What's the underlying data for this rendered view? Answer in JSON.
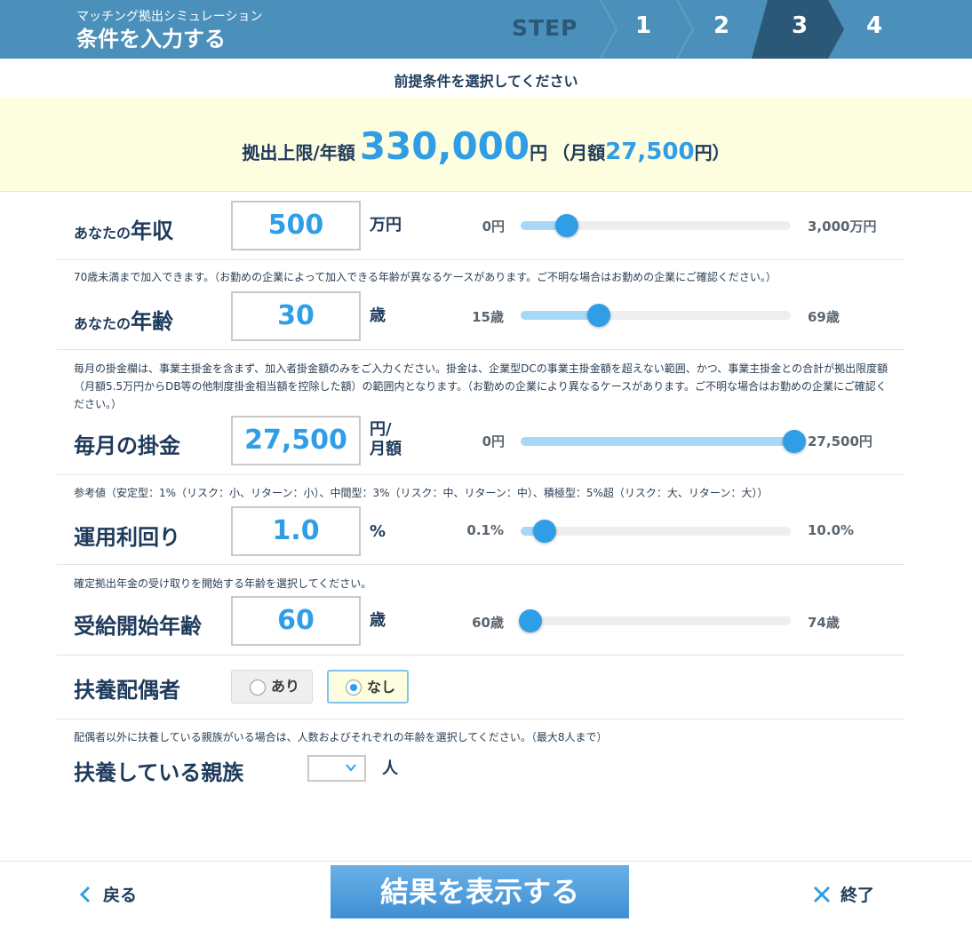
{
  "header": {
    "subtitle": "マッチング拠出シミュレーション",
    "title": "条件を入力する",
    "step_label": "STEP",
    "steps": [
      "1",
      "2",
      "3",
      "4"
    ],
    "current_step": "3"
  },
  "subheader": "前提条件を選択してください",
  "limit": {
    "label": "拠出上限/年額",
    "amount": "330,000",
    "yen": "円",
    "monthly_open": "（月額",
    "monthly_amount": "27,500",
    "monthly_close": "円）"
  },
  "income": {
    "label_small": "あなたの",
    "label": "年収",
    "value": "500",
    "unit": "万円",
    "min": "0円",
    "max": "3,000万円",
    "slider_level": 0.17
  },
  "age": {
    "note": "70歳未満まで加入できます。（お勤めの企業によって加入できる年齢が異なるケースがあります。ご不明な場合はお勤めの企業にご確認ください。）",
    "label_small": "あなたの",
    "label": "年齢",
    "value": "30",
    "unit": "歳",
    "min": "15歳",
    "max": "69歳",
    "slider_level": 0.29
  },
  "contribution": {
    "note": "毎月の掛金欄は、事業主掛金を含まず、加入者掛金額のみをご入力ください。掛金は、企業型DCの事業主掛金額を超えない範囲、かつ、事業主掛金との合計が拠出限度額（月額5.5万円からDB等の他制度掛金相当額を控除した額）の範囲内となります。（お勤めの企業により異なるケースがあります。ご不明な場合はお勤めの企業にご確認ください。）",
    "label": "毎月の掛金",
    "value": "27,500",
    "unit_line1": "円/",
    "unit_line2": "月額",
    "min": "0円",
    "max": "27,500円",
    "slider_level": 1.0
  },
  "yield": {
    "note": "参考値（安定型：1%（リスク：小、リターン：小）、中間型：3%（リスク：中、リターン：中）、積極型：5%超（リスク：大、リターン：大））",
    "label": "運用利回り",
    "value": "1.0",
    "unit": "%",
    "min": "0.1%",
    "max": "10.0%",
    "slider_level": 0.09
  },
  "start_age": {
    "note": "確定拠出年金の受け取りを開始する年齢を選択してください。",
    "label": "受給開始年齢",
    "value": "60",
    "unit": "歳",
    "min": "60歳",
    "max": "74歳",
    "slider_level": 0.0
  },
  "spouse": {
    "label": "扶養配偶者",
    "option_yes": "あり",
    "option_no": "なし",
    "selected": "なし"
  },
  "dependents": {
    "note": "配偶者以外に扶養している親族がいる場合は、人数およびそれぞれの年齢を選択してください。（最大8人まで）",
    "label": "扶養している親族",
    "unit": "人",
    "value": ""
  },
  "footer": {
    "back": "戻る",
    "result": "結果を表示する",
    "close": "終了"
  },
  "colors": {
    "header": "#4a90bb",
    "step_active": "#2a5876",
    "accent": "#2f9ee6",
    "slider_fill": "#a8d8f5",
    "limit_bg": "#fdfde0"
  }
}
